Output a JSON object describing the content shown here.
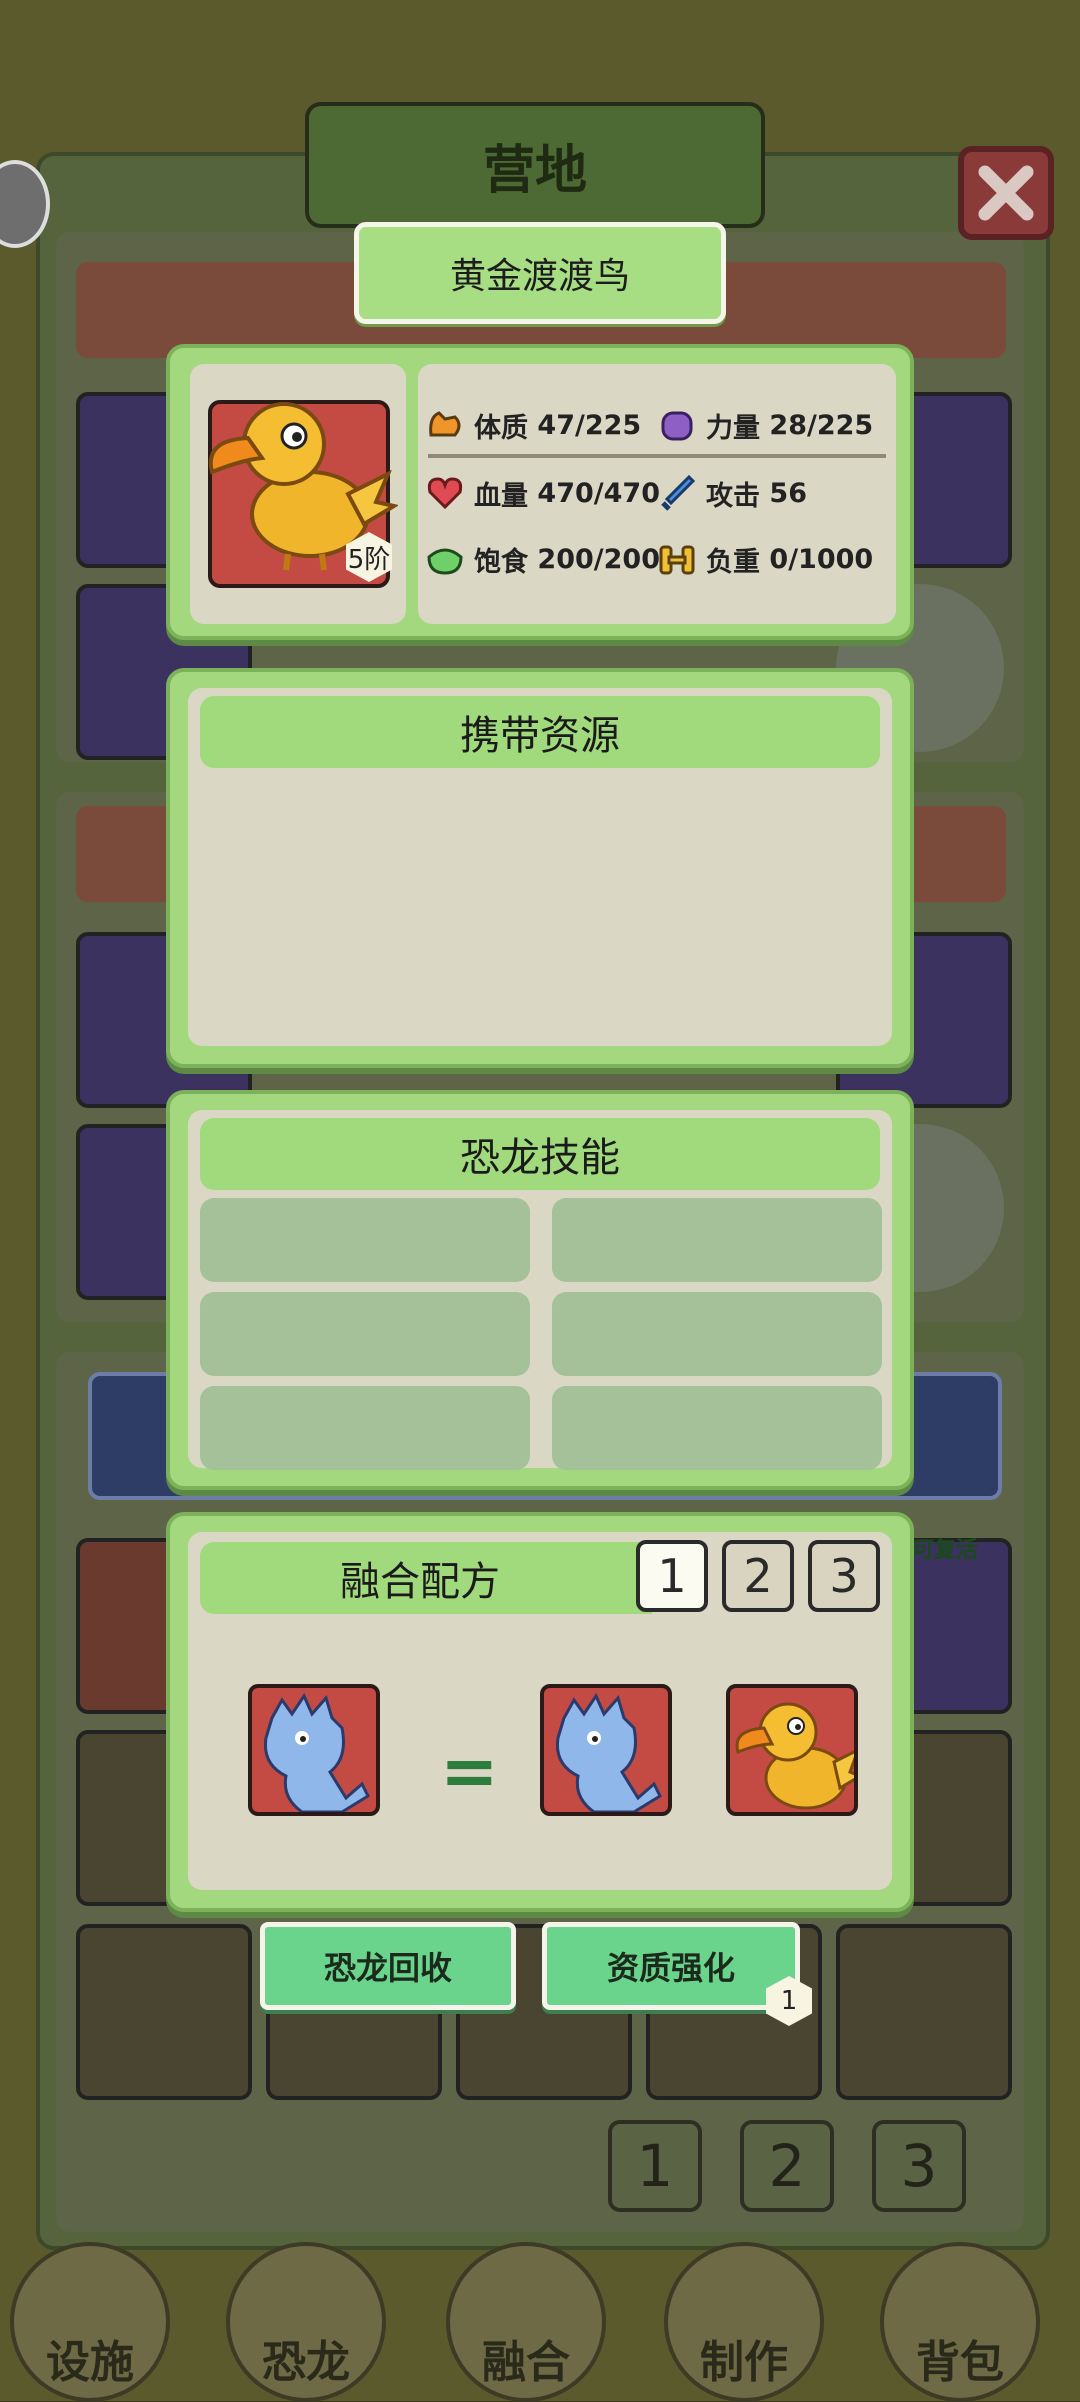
{
  "window": {
    "title": "营地"
  },
  "dino": {
    "name": "黄金渡渡鸟",
    "tier": "5阶",
    "stats": [
      {
        "icon": "muscle-icon",
        "label": "体质",
        "value": "47/225"
      },
      {
        "icon": "fist-icon",
        "label": "力量",
        "value": "28/225"
      },
      {
        "icon": "heart-icon",
        "label": "血量",
        "value": "470/470"
      },
      {
        "icon": "sword-icon",
        "label": "攻击",
        "value": "56"
      },
      {
        "icon": "food-bowl-icon",
        "label": "饱食",
        "value": "200/200"
      },
      {
        "icon": "weight-icon",
        "label": "负重",
        "value": "0/1000"
      }
    ]
  },
  "resources": {
    "title": "携带资源"
  },
  "skills": {
    "title": "恐龙技能",
    "slots": 6
  },
  "fusion": {
    "title": "融合配方",
    "recipe_tabs": [
      "1",
      "2",
      "3"
    ],
    "active_tab": "1",
    "equals": "="
  },
  "actions": {
    "recycle_label": "恐龙回收",
    "enhance_label": "资质强化",
    "enhance_badge": "1"
  },
  "pagination": [
    "1",
    "2",
    "3"
  ],
  "background": {
    "revive_text": "可复活",
    "nav": [
      "设施",
      "恐龙",
      "融合",
      "制作",
      "背包"
    ]
  },
  "colors": {
    "card_green": "#a4d87e",
    "inner_beige": "#dbd7c5",
    "action_green": "#6bd48c",
    "slot_red": "#c44a44"
  }
}
